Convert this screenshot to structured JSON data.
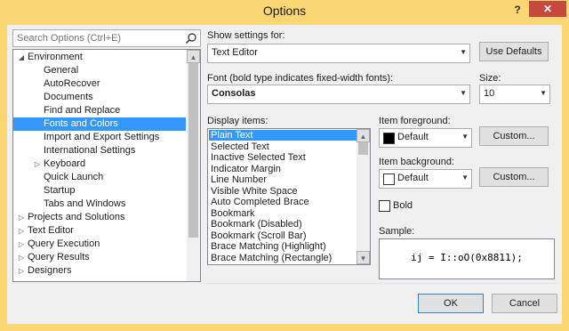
{
  "window": {
    "title": "Options",
    "help_label": "?",
    "close_label": "✕"
  },
  "search": {
    "placeholder": "Search Options (Ctrl+E)"
  },
  "tree": {
    "items": [
      {
        "label": "Environment",
        "level": 0,
        "expanded": true
      },
      {
        "label": "General",
        "level": 1
      },
      {
        "label": "AutoRecover",
        "level": 1
      },
      {
        "label": "Documents",
        "level": 1
      },
      {
        "label": "Find and Replace",
        "level": 1
      },
      {
        "label": "Fonts and Colors",
        "level": 1,
        "selected": true
      },
      {
        "label": "Import and Export Settings",
        "level": 1
      },
      {
        "label": "International Settings",
        "level": 1
      },
      {
        "label": "Keyboard",
        "level": 1,
        "collapsed": true
      },
      {
        "label": "Quick Launch",
        "level": 1
      },
      {
        "label": "Startup",
        "level": 1
      },
      {
        "label": "Tabs and Windows",
        "level": 1
      },
      {
        "label": "Projects and Solutions",
        "level": 0,
        "collapsed": true
      },
      {
        "label": "Text Editor",
        "level": 0,
        "collapsed": true
      },
      {
        "label": "Query Execution",
        "level": 0,
        "collapsed": true
      },
      {
        "label": "Query Results",
        "level": 0,
        "collapsed": true
      },
      {
        "label": "Designers",
        "level": 0,
        "collapsed": true
      }
    ]
  },
  "settings": {
    "show_settings_label": "Show settings for:",
    "show_settings_value": "Text Editor",
    "use_defaults": "Use Defaults",
    "font_label": "Font (bold type indicates fixed-width fonts):",
    "font_value": "Consolas",
    "size_label": "Size:",
    "size_value": "10",
    "display_items_label": "Display items:",
    "display_items": [
      "Plain Text",
      "Selected Text",
      "Inactive Selected Text",
      "Indicator Margin",
      "Line Number",
      "Visible White Space",
      "Auto Completed Brace",
      "Bookmark",
      "Bookmark (Disabled)",
      "Bookmark (Scroll Bar)",
      "Brace Matching (Highlight)",
      "Brace Matching (Rectangle)"
    ],
    "item_foreground_label": "Item foreground:",
    "item_foreground_value": "Default",
    "item_foreground_color": "#000000",
    "item_background_label": "Item background:",
    "item_background_value": "Default",
    "item_background_color": "#ffffff",
    "custom_label": "Custom...",
    "bold_label": "Bold",
    "sample_label": "Sample:",
    "sample_text": "ij = I::oO(0x8811);"
  },
  "footer": {
    "ok": "OK",
    "cancel": "Cancel"
  }
}
